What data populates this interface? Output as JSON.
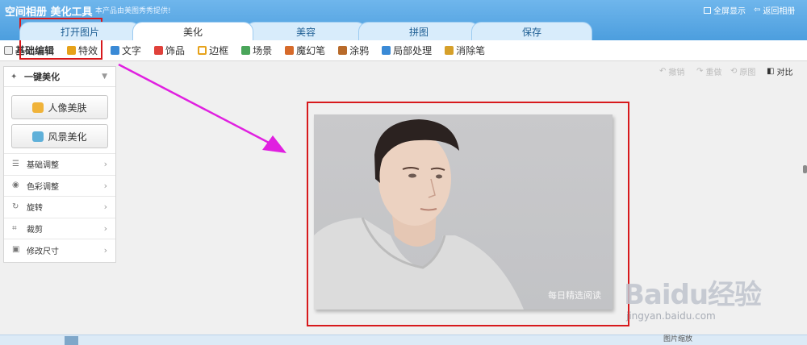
{
  "header": {
    "app_title": "空间相册 美化工具",
    "subtitle": "本产品由美图秀秀提供!",
    "fullscreen_label": "全屏显示",
    "back_label": "返回相册"
  },
  "tabs": [
    {
      "label": "打开图片",
      "active": false
    },
    {
      "label": "美化",
      "active": true
    },
    {
      "label": "美容",
      "active": false
    },
    {
      "label": "拼图",
      "active": false
    },
    {
      "label": "保存",
      "active": false
    }
  ],
  "toolbar": {
    "items": [
      {
        "label": "基础编辑",
        "icon": "doc-icon",
        "color": "#7a7a7a"
      },
      {
        "label": "特效",
        "icon": "wand-icon",
        "color": "#e6a21a"
      },
      {
        "label": "文字",
        "icon": "text-icon",
        "color": "#3a8ad6"
      },
      {
        "label": "饰品",
        "icon": "bow-icon",
        "color": "#e0413b"
      },
      {
        "label": "边框",
        "icon": "frame-icon",
        "color": "#e6a21a"
      },
      {
        "label": "场景",
        "icon": "scene-icon",
        "color": "#4aa55a"
      },
      {
        "label": "魔幻笔",
        "icon": "magic-pen-icon",
        "color": "#d66a2a"
      },
      {
        "label": "涂鸦",
        "icon": "brush-icon",
        "color": "#b86a2a"
      },
      {
        "label": "局部处理",
        "icon": "local-icon",
        "color": "#3a8ad6"
      },
      {
        "label": "消除笔",
        "icon": "eraser-icon",
        "color": "#d6a02a"
      }
    ]
  },
  "panel": {
    "header": "一键美化",
    "portrait_button": "人像美肤",
    "scenery_button": "风景美化",
    "items": [
      {
        "label": "基础调整",
        "icon": "sliders-icon"
      },
      {
        "label": "色彩调整",
        "icon": "palette-icon"
      },
      {
        "label": "旋转",
        "icon": "rotate-icon"
      },
      {
        "label": "裁剪",
        "icon": "crop-icon"
      },
      {
        "label": "修改尺寸",
        "icon": "resize-icon"
      }
    ]
  },
  "actions": {
    "undo": "撤销",
    "redo": "重做",
    "reset": "原图",
    "compare": "对比"
  },
  "canvas": {
    "watermark": "每日精选阅读"
  },
  "baidu": {
    "logo": "Baidu经验",
    "url": "jingyan.baidu.com"
  },
  "statusbar": {
    "item": "图片缩放"
  },
  "colors": {
    "header": "#5aa8e6",
    "highlight": "#d7191c",
    "arrow": "#e020e0"
  }
}
